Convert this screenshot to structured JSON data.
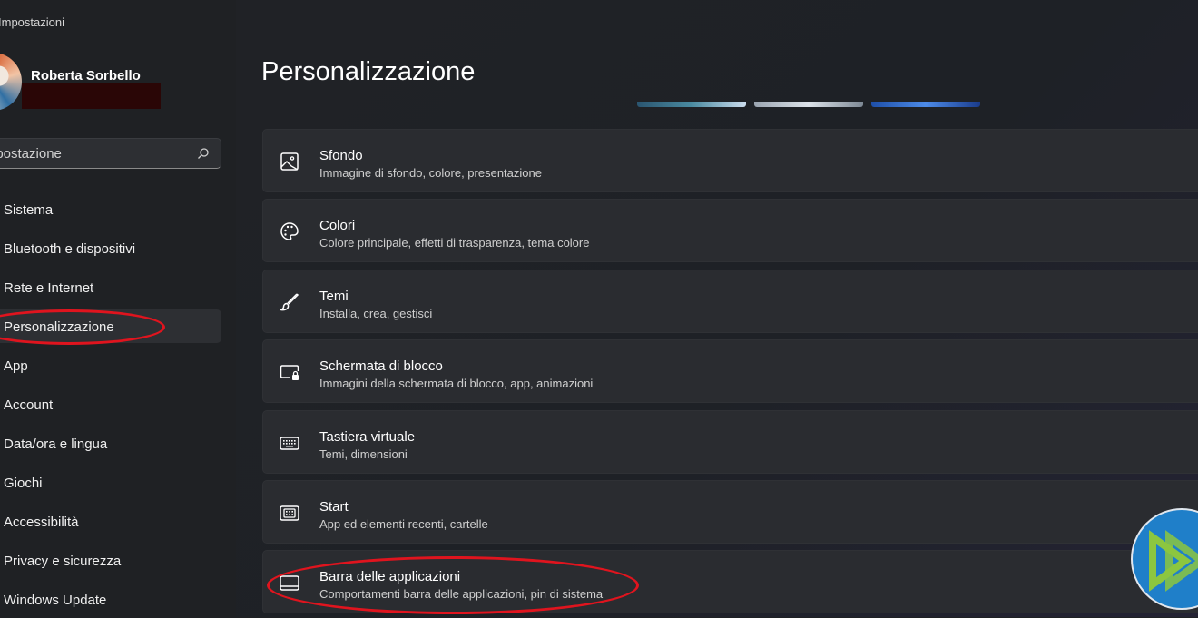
{
  "window": {
    "title": "Impostazioni"
  },
  "user": {
    "name": "Roberta Sorbello"
  },
  "search": {
    "placeholder": "Trova un'impostazione"
  },
  "sidebar": {
    "items": [
      {
        "label": "Sistema"
      },
      {
        "label": "Bluetooth e dispositivi"
      },
      {
        "label": "Rete e Internet"
      },
      {
        "label": "Personalizzazione",
        "selected": true
      },
      {
        "label": "App"
      },
      {
        "label": "Account"
      },
      {
        "label": "Data/ora e lingua"
      },
      {
        "label": "Giochi"
      },
      {
        "label": "Accessibilità"
      },
      {
        "label": "Privacy e sicurezza"
      },
      {
        "label": "Windows Update"
      }
    ]
  },
  "main": {
    "title": "Personalizzazione",
    "cards": [
      {
        "title": "Sfondo",
        "subtitle": "Immagine di sfondo, colore, presentazione",
        "icon": "image-icon"
      },
      {
        "title": "Colori",
        "subtitle": "Colore principale, effetti di trasparenza, tema colore",
        "icon": "palette-icon"
      },
      {
        "title": "Temi",
        "subtitle": "Installa, crea, gestisci",
        "icon": "brush-icon"
      },
      {
        "title": "Schermata di blocco",
        "subtitle": "Immagini della schermata di blocco, app, animazioni",
        "icon": "lock-screen-icon"
      },
      {
        "title": "Tastiera virtuale",
        "subtitle": "Temi, dimensioni",
        "icon": "keyboard-icon"
      },
      {
        "title": "Start",
        "subtitle": "App ed elementi recenti, cartelle",
        "icon": "start-icon"
      },
      {
        "title": "Barra delle applicazioni",
        "subtitle": "Comportamenti barra delle applicazioni, pin di sistema",
        "icon": "taskbar-icon"
      }
    ]
  },
  "colors": {
    "annotation": "#e0141e",
    "background": "#1f2124",
    "card": "#2a2c30"
  }
}
